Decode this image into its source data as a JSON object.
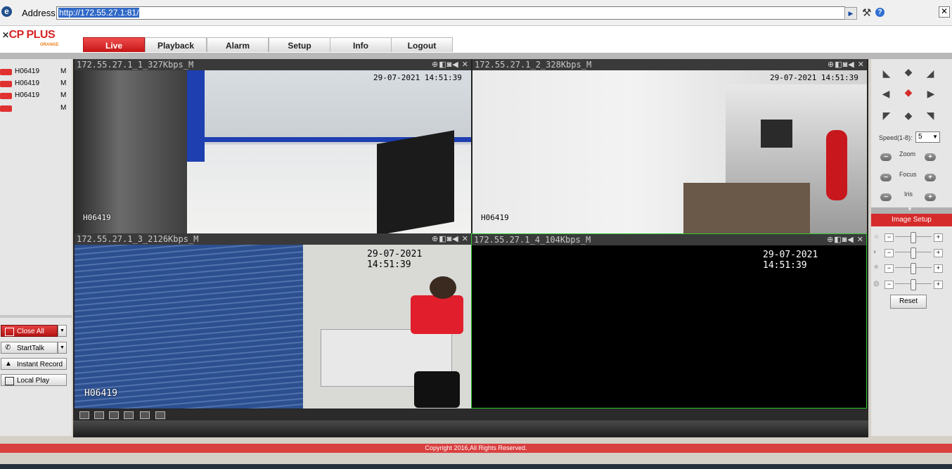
{
  "browser": {
    "address_label": "Address:",
    "url": "http://172.55.27.1:81/",
    "go_glyph": "▶",
    "close_glyph": "✕"
  },
  "header": {
    "logo_main": "CP PLUS",
    "logo_sub": "ORANGE",
    "tabs": [
      {
        "label": "Live",
        "active": true
      },
      {
        "label": "Playback"
      },
      {
        "label": "Alarm"
      },
      {
        "label": "Setup"
      },
      {
        "label": "Info"
      },
      {
        "label": "Logout"
      }
    ]
  },
  "devices": [
    {
      "name": "H06419",
      "mode": "M"
    },
    {
      "name": "H06419",
      "mode": "M"
    },
    {
      "name": "H06419",
      "mode": "M"
    },
    {
      "name": "",
      "mode": "M"
    }
  ],
  "left_buttons": {
    "close_all": "Close All",
    "start_talk": "StartTalk",
    "instant_record": "Instant Record",
    "local_play": "Local Play"
  },
  "panes": [
    {
      "title": "172.55.27.1_1_327Kbps_M",
      "timestamp": "29-07-2021 14:51:39",
      "camera": "H06419"
    },
    {
      "title": "172.55.27.1_2_328Kbps_M",
      "timestamp": "29-07-2021 14:51:39",
      "camera": "H06419"
    },
    {
      "title": "172.55.27.1_3_2126Kbps_M",
      "timestamp": "29-07-2021 14:51:39",
      "camera": "H06419"
    },
    {
      "title": "172.55.27.1_4_104Kbps_M",
      "timestamp": "29-07-2021 14:51:39",
      "camera": ""
    }
  ],
  "pane_tools": "⊕◧◙◀ ✕",
  "ptz": {
    "speed_label": "Speed(1-8):",
    "speed_value": "5",
    "zoom_label": "Zoom",
    "focus_label": "Focus",
    "iris_label": "Iris"
  },
  "image_setup": {
    "title": "Image Setup",
    "reset_label": "Reset",
    "sliders": [
      {
        "name": "brightness",
        "level": 0.5
      },
      {
        "name": "contrast",
        "level": 0.5
      },
      {
        "name": "saturation",
        "level": 0.5
      },
      {
        "name": "hue",
        "level": 0.5
      }
    ]
  },
  "footer": {
    "copyright": "Copyright 2016,All Rights Reserved."
  }
}
